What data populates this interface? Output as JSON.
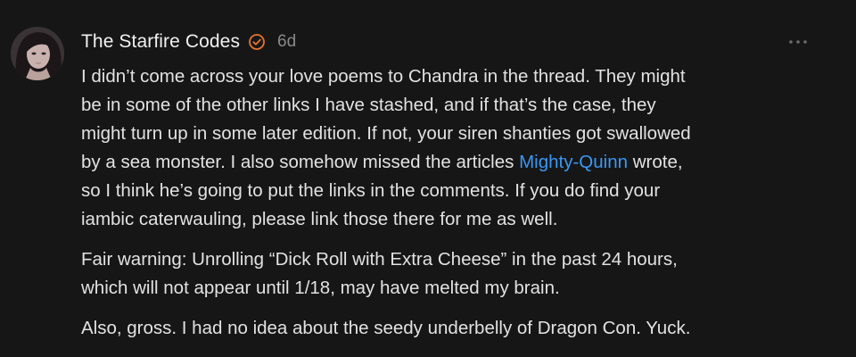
{
  "comment": {
    "author": "The Starfire Codes",
    "timestamp": "6d",
    "verified_icon": "verified-badge-icon",
    "more_icon": "ellipsis-icon",
    "colors": {
      "background": "#161616",
      "mention": "#3a98f5",
      "verified": "#e8742a",
      "meta": "#8a8a8a"
    },
    "paragraph1": {
      "line1": "I didn’t come across your love poems to Chandra in the thread. They might",
      "line2": "be in some of the other links I have stashed, and if that’s the case, they",
      "line3": "might turn up in some later edition. If not, your siren shanties got swallowed",
      "line4_before": "by a sea monster. I also somehow missed the articles ",
      "line4_mention": "Mighty-Quinn",
      "line4_after": " wrote,",
      "line5": "so I think he’s going to put the links in the comments. If you do find your",
      "line6": "iambic caterwauling, please link those there for me as well."
    },
    "paragraph2": {
      "line1": "Fair warning: Unrolling “Dick Roll with Extra Cheese” in the past 24 hours,",
      "line2": "which will not appear until 1/18, may have melted my brain."
    },
    "paragraph3": {
      "line1": "Also, gross. I had no idea about the seedy underbelly of Dragon Con. Yuck."
    }
  }
}
